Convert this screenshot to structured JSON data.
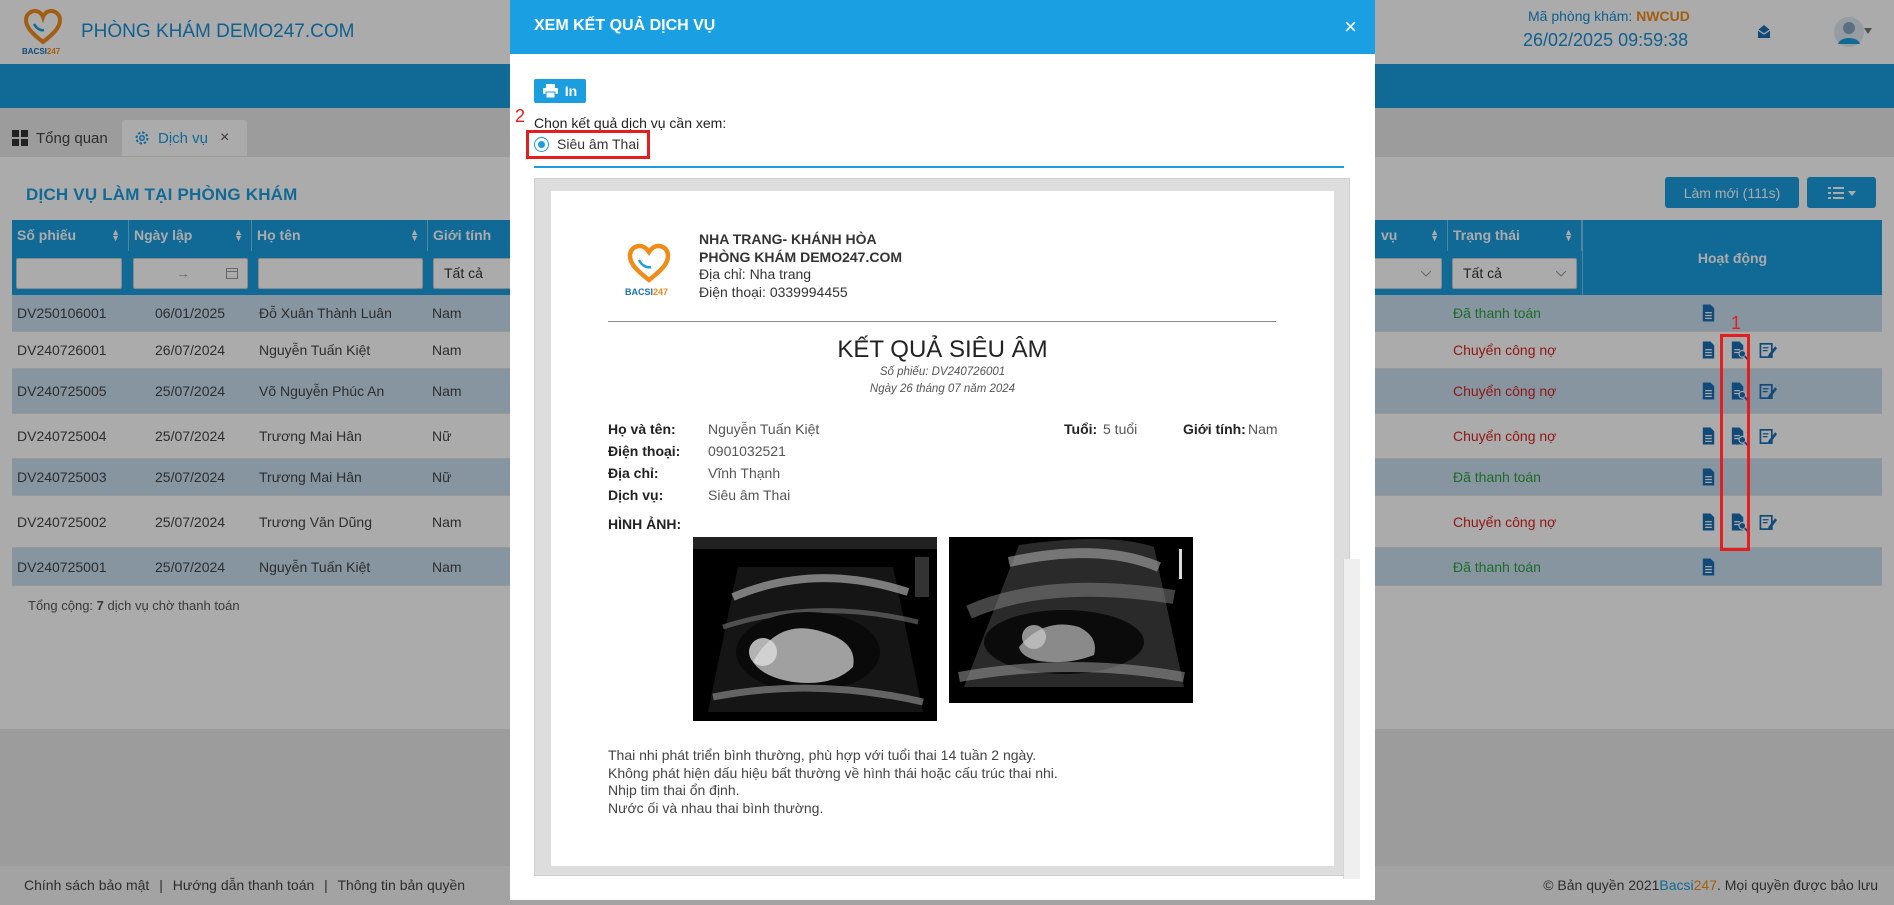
{
  "header": {
    "clinic_name": "PHÒNG KHÁM DEMO247.COM",
    "logo_text": "BACSI247",
    "room_code_label": "Mã phòng khám:",
    "room_code": "NWCUD",
    "datetime": "26/02/2025 09:59:38"
  },
  "tabs": [
    {
      "label": "Tổng quan"
    },
    {
      "label": "Dịch vụ"
    }
  ],
  "panel": {
    "title": "DỊCH VỤ LÀM TẠI PHÒNG KHÁM",
    "refresh_label": "Làm mới (111s)"
  },
  "table": {
    "columns": {
      "so_phieu": "Số phiếu",
      "ngay_lap": "Ngày lập",
      "ho_ten": "Họ tên",
      "gioi_tinh": "Giới tính",
      "dich_vu": "vụ",
      "trang_thai": "Trạng thái",
      "hoat_dong": "Hoạt động"
    },
    "filters": {
      "date_arrow": "→",
      "gioi_tinh": "Tất cả",
      "trang_thai": "Tất cả"
    },
    "rows": [
      {
        "so_phieu": "DV250106001",
        "ngay_lap": "06/01/2025",
        "ho_ten": "Đỗ Xuân Thành Luân",
        "gioi_tinh": "Nam",
        "trang_thai": "Đã thanh toán"
      },
      {
        "so_phieu": "DV240726001",
        "ngay_lap": "26/07/2024",
        "ho_ten": "Nguyễn Tuấn Kiệt",
        "gioi_tinh": "Nam",
        "trang_thai": "Chuyển công nợ"
      },
      {
        "so_phieu": "DV240725005",
        "ngay_lap": "25/07/2024",
        "ho_ten": "Võ Nguyễn Phúc An",
        "gioi_tinh": "Nam",
        "trang_thai": "Chuyển công nợ"
      },
      {
        "so_phieu": "DV240725004",
        "ngay_lap": "25/07/2024",
        "ho_ten": "Trương Mai Hân",
        "gioi_tinh": "Nữ",
        "trang_thai": "Chuyển công nợ"
      },
      {
        "so_phieu": "DV240725003",
        "ngay_lap": "25/07/2024",
        "ho_ten": "Trương Mai Hân",
        "gioi_tinh": "Nữ",
        "trang_thai": "Đã thanh toán"
      },
      {
        "so_phieu": "DV240725002",
        "ngay_lap": "25/07/2024",
        "ho_ten": "Trương Văn Dũng",
        "gioi_tinh": "Nam",
        "trang_thai": "Chuyển công nợ"
      },
      {
        "so_phieu": "DV240725001",
        "ngay_lap": "25/07/2024",
        "ho_ten": "Nguyễn Tuấn Kiệt",
        "gioi_tinh": "Nam",
        "trang_thai": "Đã thanh toán"
      }
    ],
    "total_prefix": "Tổng cộng: ",
    "total_count": "7",
    "total_suffix": " dịch vụ chờ thanh toán"
  },
  "footer": {
    "links": [
      "Chính sách bảo mật",
      "Hướng dẫn thanh toán",
      "Thông tin bản quyền"
    ],
    "separator": "|",
    "copyright_prefix": "© Bản quyền 2021",
    "brand_a": "Bacsi",
    "brand_b": "247",
    "copyright_suffix": ". Mọi quyền được bảo lưu"
  },
  "annotations": {
    "mark1": "1",
    "mark2": "2"
  },
  "modal": {
    "title": "XEM KẾT QUẢ DỊCH VỤ",
    "close": "×",
    "print_label": "In",
    "choose_label": "Chọn kết quả dịch vụ cần xem:",
    "option": "Siêu âm Thai",
    "report": {
      "org_line1": "NHA TRANG- KHÁNH HÒA",
      "org_line2": "PHÒNG KHÁM DEMO247.COM",
      "address": "Địa chỉ: Nha trang",
      "phone": "Điện thoại: 0339994455",
      "title": "KẾT QUẢ SIÊU ÂM",
      "receipt": "Số phiếu: DV240726001",
      "date": "Ngày 26 tháng 07 năm 2024",
      "name_label": "Họ và tên:",
      "name": "Nguyễn Tuấn Kiệt",
      "age_label": "Tuổi:",
      "age": "5 tuổi",
      "sex_label": "Giới tính:",
      "sex": "Nam",
      "phone_label": "Điện thoại:",
      "patient_phone": "0901032521",
      "address_label": "Địa chỉ:",
      "patient_address": "Vĩnh Thạnh",
      "service_label": "Dịch vụ:",
      "service": "Siêu âm Thai",
      "images_label": "HÌNH ẢNH:",
      "conclusion": [
        "Thai nhi phát triển bình thường, phù hợp với tuổi thai 14 tuần 2 ngày.",
        "Không phát hiện dấu hiệu bất thường về hình thái hoặc cấu trúc thai nhi.",
        "Nhịp tim thai ổn định.",
        "Nước ối và nhau thai bình thường."
      ]
    }
  },
  "colors": {
    "primary": "#1a9ee0",
    "paid": "#2e9e3a",
    "debt": "#d9231f",
    "brand_orange": "#f08c1a",
    "highlight": "#e21e1e"
  }
}
